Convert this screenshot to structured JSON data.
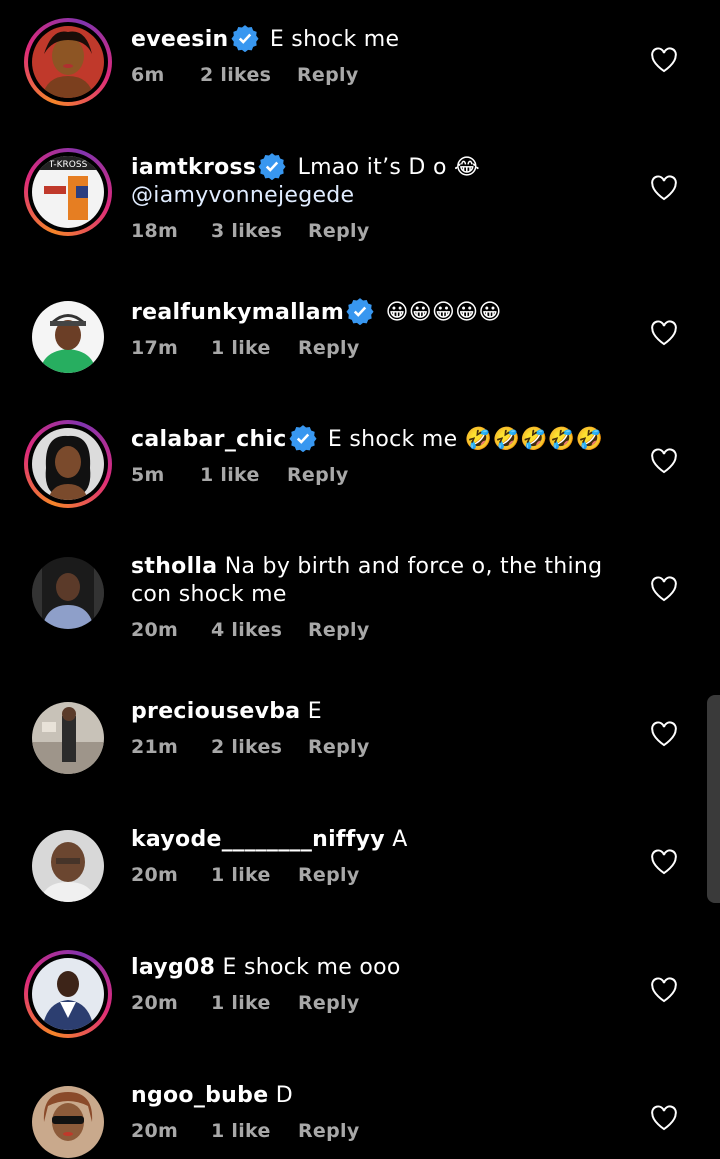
{
  "comments": [
    {
      "username": "eveesin",
      "verified": true,
      "text": "E shock me",
      "time": "6m",
      "likes": "2 likes",
      "reply": "Reply"
    },
    {
      "username": "iamtkross",
      "verified": true,
      "text": "Lmao it’s D o",
      "emoji": "😂",
      "mention": "@iamyvonnejegede",
      "time": "18m",
      "likes": "3 likes",
      "reply": "Reply"
    },
    {
      "username": "realfunkymallam",
      "verified": true,
      "text": "",
      "emoji": "😀😀😀😀😀",
      "time": "17m",
      "likes": "1 like",
      "reply": "Reply"
    },
    {
      "username": "calabar_chic",
      "verified": true,
      "text": "E shock me",
      "emoji": "🤣🤣🤣🤣🤣",
      "time": "5m",
      "likes": "1 like",
      "reply": "Reply"
    },
    {
      "username": "stholla",
      "verified": false,
      "text": "Na by birth and force o, the thing con shock me",
      "time": "20m",
      "likes": "4 likes",
      "reply": "Reply"
    },
    {
      "username": "preciousevba",
      "verified": false,
      "text": "E",
      "time": "21m",
      "likes": "2 likes",
      "reply": "Reply"
    },
    {
      "username": "kayode________niffyy",
      "verified": false,
      "text": "A",
      "time": "20m",
      "likes": "1 like",
      "reply": "Reply"
    },
    {
      "username": "layg08",
      "verified": false,
      "text": "E shock me ooo",
      "time": "20m",
      "likes": "1 like",
      "reply": "Reply"
    },
    {
      "username": "ngoo_bube",
      "verified": false,
      "text": "D",
      "time": "20m",
      "likes": "1 like",
      "reply": "Reply"
    }
  ],
  "avatar_avatar2_label": "T-KROSS",
  "colors": {
    "background": "#000000",
    "text": "#ffffff",
    "meta": "#a8a8a8",
    "verified": "#3897f0",
    "story_ring": [
      "#f58529",
      "#dd2a7b",
      "#8134af"
    ]
  },
  "icons": {
    "verified": "verified-badge-icon",
    "like": "heart-outline-icon"
  }
}
